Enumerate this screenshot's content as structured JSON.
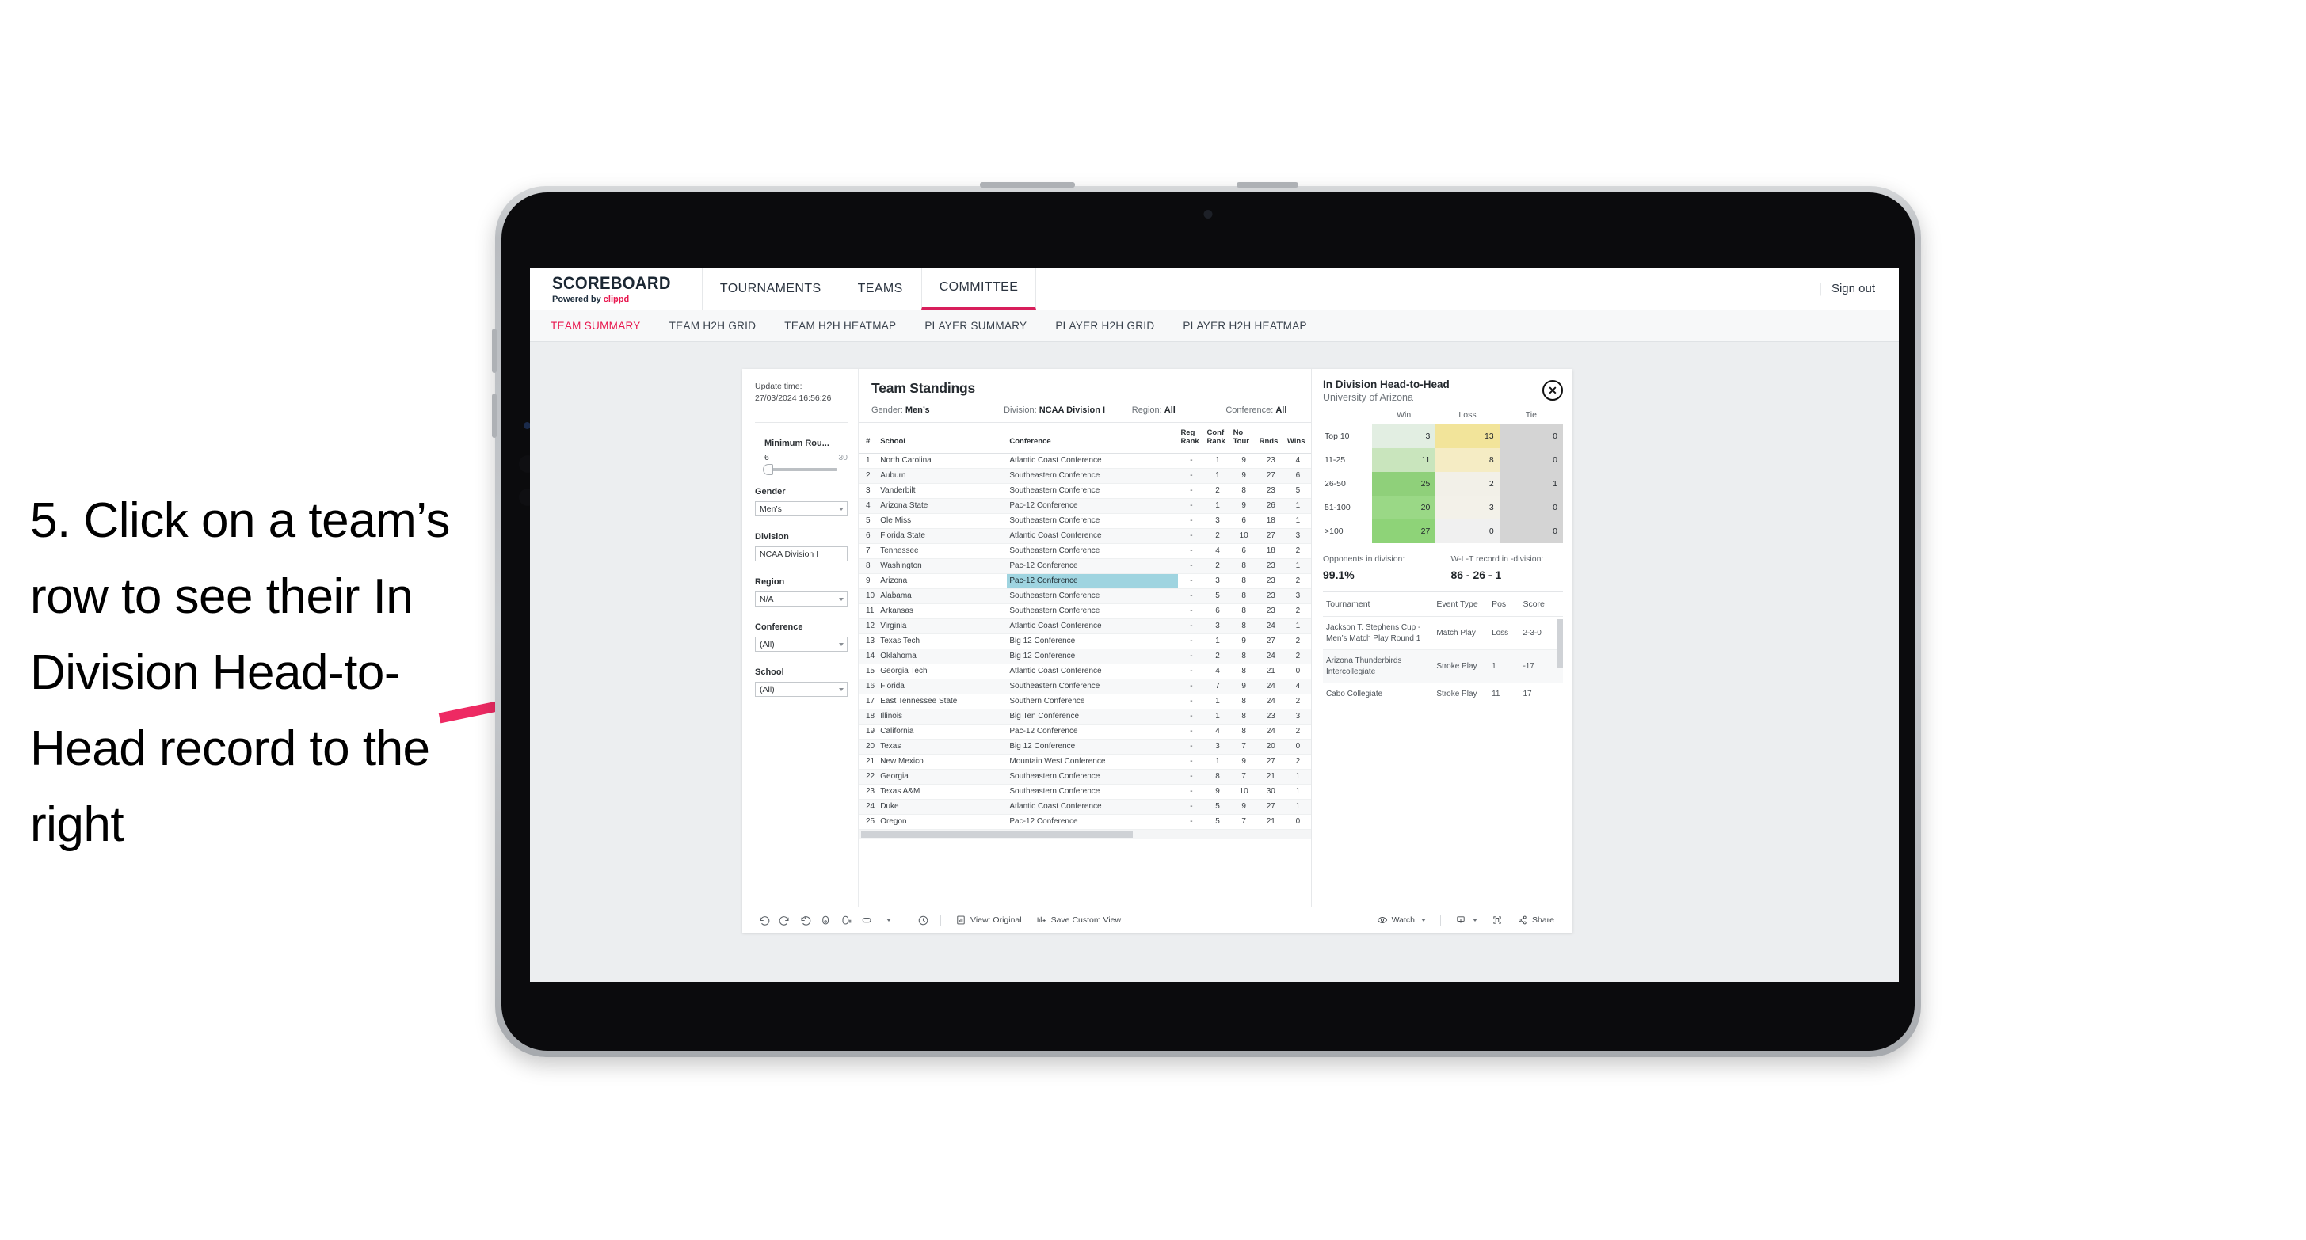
{
  "instruction": {
    "text": "5. Click on a team’s row to see their In Division Head-to-Head record to the right",
    "arrow_color": "#ee2a63"
  },
  "navbar": {
    "brand_title": "SCOREBOARD",
    "brand_sub_prefix": "Powered by ",
    "brand_sub_accent": "clippd",
    "items": [
      {
        "label": "TOURNAMENTS",
        "active": false
      },
      {
        "label": "TEAMS",
        "active": false
      },
      {
        "label": "COMMITTEE",
        "active": true
      }
    ],
    "divider": "|",
    "signout": "Sign out",
    "active_color": "#d81e5b"
  },
  "subnav": {
    "items": [
      {
        "label": "TEAM SUMMARY",
        "active": true
      },
      {
        "label": "TEAM H2H GRID",
        "active": false
      },
      {
        "label": "TEAM H2H HEATMAP",
        "active": false
      },
      {
        "label": "PLAYER SUMMARY",
        "active": false
      },
      {
        "label": "PLAYER H2H GRID",
        "active": false
      },
      {
        "label": "PLAYER H2H HEATMAP",
        "active": false
      }
    ]
  },
  "filters": {
    "update_time_label": "Update time:",
    "update_time_value": "27/03/2024 16:56:26",
    "slider": {
      "label": "Minimum Rou...",
      "min": "6",
      "max": "30"
    },
    "selects": [
      {
        "label": "Gender",
        "value": "Men’s"
      },
      {
        "label": "Division",
        "value": "NCAA Division I"
      },
      {
        "label": "Region",
        "value": "N/A"
      },
      {
        "label": "Conference",
        "value": "(All)"
      },
      {
        "label": "School",
        "value": "(All)"
      }
    ]
  },
  "standings": {
    "title": "Team Standings",
    "filter_row": [
      {
        "label": "Gender: ",
        "value": "Men’s"
      },
      {
        "label": "Division: ",
        "value": "NCAA Division I"
      },
      {
        "label": "Region: ",
        "value": "All"
      },
      {
        "label": "Conference: ",
        "value": "All"
      }
    ],
    "columns": [
      "#",
      "School",
      "Conference",
      "Reg Rank",
      "Conf Rank",
      "No Tour",
      "Rnds",
      "Wins"
    ],
    "rows": [
      {
        "n": "1",
        "school": "North Carolina",
        "conf": "Atlantic Coast Conference",
        "reg": "-",
        "cr": "1",
        "nt": "9",
        "rnds": "23",
        "wins": "4"
      },
      {
        "n": "2",
        "school": "Auburn",
        "conf": "Southeastern Conference",
        "reg": "-",
        "cr": "1",
        "nt": "9",
        "rnds": "27",
        "wins": "6"
      },
      {
        "n": "3",
        "school": "Vanderbilt",
        "conf": "Southeastern Conference",
        "reg": "-",
        "cr": "2",
        "nt": "8",
        "rnds": "23",
        "wins": "5"
      },
      {
        "n": "4",
        "school": "Arizona State",
        "conf": "Pac-12 Conference",
        "reg": "-",
        "cr": "1",
        "nt": "9",
        "rnds": "26",
        "wins": "1"
      },
      {
        "n": "5",
        "school": "Ole Miss",
        "conf": "Southeastern Conference",
        "reg": "-",
        "cr": "3",
        "nt": "6",
        "rnds": "18",
        "wins": "1"
      },
      {
        "n": "6",
        "school": "Florida State",
        "conf": "Atlantic Coast Conference",
        "reg": "-",
        "cr": "2",
        "nt": "10",
        "rnds": "27",
        "wins": "3"
      },
      {
        "n": "7",
        "school": "Tennessee",
        "conf": "Southeastern Conference",
        "reg": "-",
        "cr": "4",
        "nt": "6",
        "rnds": "18",
        "wins": "2"
      },
      {
        "n": "8",
        "school": "Washington",
        "conf": "Pac-12 Conference",
        "reg": "-",
        "cr": "2",
        "nt": "8",
        "rnds": "23",
        "wins": "1"
      },
      {
        "n": "9",
        "school": "Arizona",
        "conf": "Pac-12 Conference",
        "reg": "-",
        "cr": "3",
        "nt": "8",
        "rnds": "23",
        "wins": "2",
        "selected": true
      },
      {
        "n": "10",
        "school": "Alabama",
        "conf": "Southeastern Conference",
        "reg": "-",
        "cr": "5",
        "nt": "8",
        "rnds": "23",
        "wins": "3"
      },
      {
        "n": "11",
        "school": "Arkansas",
        "conf": "Southeastern Conference",
        "reg": "-",
        "cr": "6",
        "nt": "8",
        "rnds": "23",
        "wins": "2"
      },
      {
        "n": "12",
        "school": "Virginia",
        "conf": "Atlantic Coast Conference",
        "reg": "-",
        "cr": "3",
        "nt": "8",
        "rnds": "24",
        "wins": "1"
      },
      {
        "n": "13",
        "school": "Texas Tech",
        "conf": "Big 12 Conference",
        "reg": "-",
        "cr": "1",
        "nt": "9",
        "rnds": "27",
        "wins": "2"
      },
      {
        "n": "14",
        "school": "Oklahoma",
        "conf": "Big 12 Conference",
        "reg": "-",
        "cr": "2",
        "nt": "8",
        "rnds": "24",
        "wins": "2"
      },
      {
        "n": "15",
        "school": "Georgia Tech",
        "conf": "Atlantic Coast Conference",
        "reg": "-",
        "cr": "4",
        "nt": "8",
        "rnds": "21",
        "wins": "0"
      },
      {
        "n": "16",
        "school": "Florida",
        "conf": "Southeastern Conference",
        "reg": "-",
        "cr": "7",
        "nt": "9",
        "rnds": "24",
        "wins": "4"
      },
      {
        "n": "17",
        "school": "East Tennessee State",
        "conf": "Southern Conference",
        "reg": "-",
        "cr": "1",
        "nt": "8",
        "rnds": "24",
        "wins": "2"
      },
      {
        "n": "18",
        "school": "Illinois",
        "conf": "Big Ten Conference",
        "reg": "-",
        "cr": "1",
        "nt": "8",
        "rnds": "23",
        "wins": "3"
      },
      {
        "n": "19",
        "school": "California",
        "conf": "Pac-12 Conference",
        "reg": "-",
        "cr": "4",
        "nt": "8",
        "rnds": "24",
        "wins": "2"
      },
      {
        "n": "20",
        "school": "Texas",
        "conf": "Big 12 Conference",
        "reg": "-",
        "cr": "3",
        "nt": "7",
        "rnds": "20",
        "wins": "0"
      },
      {
        "n": "21",
        "school": "New Mexico",
        "conf": "Mountain West Conference",
        "reg": "-",
        "cr": "1",
        "nt": "9",
        "rnds": "27",
        "wins": "2"
      },
      {
        "n": "22",
        "school": "Georgia",
        "conf": "Southeastern Conference",
        "reg": "-",
        "cr": "8",
        "nt": "7",
        "rnds": "21",
        "wins": "1"
      },
      {
        "n": "23",
        "school": "Texas A&M",
        "conf": "Southeastern Conference",
        "reg": "-",
        "cr": "9",
        "nt": "10",
        "rnds": "30",
        "wins": "1"
      },
      {
        "n": "24",
        "school": "Duke",
        "conf": "Atlantic Coast Conference",
        "reg": "-",
        "cr": "5",
        "nt": "9",
        "rnds": "27",
        "wins": "1"
      },
      {
        "n": "25",
        "school": "Oregon",
        "conf": "Pac-12 Conference",
        "reg": "-",
        "cr": "5",
        "nt": "7",
        "rnds": "21",
        "wins": "0"
      }
    ],
    "selected_row_color": "#9fd4e0"
  },
  "h2h": {
    "title": "In Division Head-to-Head",
    "subtitle": "University of Arizona",
    "close_icon": "close-circle-icon",
    "close_glyph": "✕",
    "columns": [
      "",
      "Win",
      "Loss",
      "Tie"
    ],
    "rows": [
      {
        "band": "Top 10",
        "win": "3",
        "loss": "13",
        "tie": "0",
        "win_color": "#e2eee2",
        "loss_color": "#f2e49a",
        "tie_color": "#d4d4d4"
      },
      {
        "band": "11-25",
        "win": "11",
        "loss": "8",
        "tie": "0",
        "win_color": "#c9e5bd",
        "loss_color": "#f5ecc4",
        "tie_color": "#d4d4d4"
      },
      {
        "band": "26-50",
        "win": "25",
        "loss": "2",
        "tie": "1",
        "win_color": "#8fd07a",
        "loss_color": "#f2f0e8",
        "tie_color": "#d4d4d4"
      },
      {
        "band": "51-100",
        "win": "20",
        "loss": "3",
        "tie": "0",
        "win_color": "#9ad886",
        "loss_color": "#f3f1e9",
        "tie_color": "#d4d4d4"
      },
      {
        "band": ">100",
        "win": "27",
        "loss": "0",
        "tie": "0",
        "win_color": "#8ed378",
        "loss_color": "#f0f0f0",
        "tie_color": "#d4d4d4"
      }
    ],
    "stats": [
      {
        "label": "Opponents in division:",
        "value": "99.1%"
      },
      {
        "label": "W-L-T record in -division:",
        "value": "86 - 26 - 1"
      }
    ],
    "tournament_columns": [
      "Tournament",
      "Event Type",
      "Pos",
      "Score"
    ],
    "tournaments": [
      {
        "name": "Jackson T. Stephens Cup - Men’s Match Play Round 1",
        "type": "Match Play",
        "pos": "Loss",
        "score": "2-3-0"
      },
      {
        "name": "Arizona Thunderbirds Intercollegiate",
        "type": "Stroke Play",
        "pos": "1",
        "score": "-17"
      },
      {
        "name": "Cabo Collegiate",
        "type": "Stroke Play",
        "pos": "11",
        "score": "17"
      }
    ]
  },
  "toolbar": {
    "icons": [
      "undo-icon",
      "redo-icon",
      "revert-icon",
      "refresh-data-icon",
      "pause-refresh-icon",
      "zoom-shape-icon"
    ],
    "clock_icon": "history-icon",
    "view_label": "View: Original",
    "save_label": "Save Custom View",
    "watch_label": "Watch",
    "download_icon": "download-icon",
    "fullscreen_icon": "fullscreen-icon",
    "share_label": "Share"
  }
}
